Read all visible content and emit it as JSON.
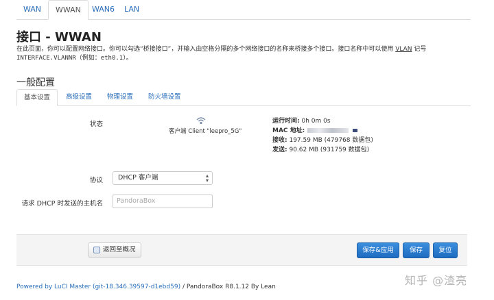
{
  "top_tabs": [
    {
      "label": "WAN",
      "active": false
    },
    {
      "label": "WWAN",
      "active": true
    },
    {
      "label": "WAN6",
      "active": false
    },
    {
      "label": "LAN",
      "active": false
    }
  ],
  "page": {
    "title": "接口 - WWAN",
    "desc_line1_pre": "在此页面，你可以配置网络接口。你可以勾选“桥接接口”，并输入由空格分隔的多个网络接口的名称来桥接多个接口。接口名称中可以使用 ",
    "desc_line1_link": "VLAN",
    "desc_line1_post": " 记号",
    "desc_line2_mono": "INTERFACE.VLANNR",
    "desc_line2_mid": "（例如：",
    "desc_line2_mono2": "eth0.1",
    "desc_line2_end": "）。"
  },
  "section": {
    "title": "一般配置",
    "tabs": [
      {
        "label": "基本设置",
        "active": true
      },
      {
        "label": "高级设置",
        "active": false
      },
      {
        "label": "物理设置",
        "active": false
      },
      {
        "label": "防火墙设置",
        "active": false
      }
    ]
  },
  "status": {
    "label": "状态",
    "client_text": "客户端 Client \"leepro_5G\"",
    "uptime_label": "运行时间:",
    "uptime_value": "0h 0m 0s",
    "mac_label": "MAC 地址:",
    "rx_label": "接收:",
    "rx_value": "197.59 MB (479768 数据包)",
    "tx_label": "发送:",
    "tx_value": "90.62 MB (931759 数据包)"
  },
  "protocol": {
    "label": "协议",
    "value": "DHCP 客户端"
  },
  "hostname": {
    "label": "请求 DHCP 时发送的主机名",
    "placeholder": "PandoraBox"
  },
  "actions": {
    "back_label": "返回至概况",
    "save_apply_label": "保存&应用",
    "save_label": "保存",
    "reset_label": "复位"
  },
  "footer": {
    "link_text": "Powered by LuCI Master (git-18.346.39597-d1ebd59)",
    "rest_text": " / PandoraBox R8.1.12 By Lean"
  },
  "watermark": "知乎 @渣亮"
}
